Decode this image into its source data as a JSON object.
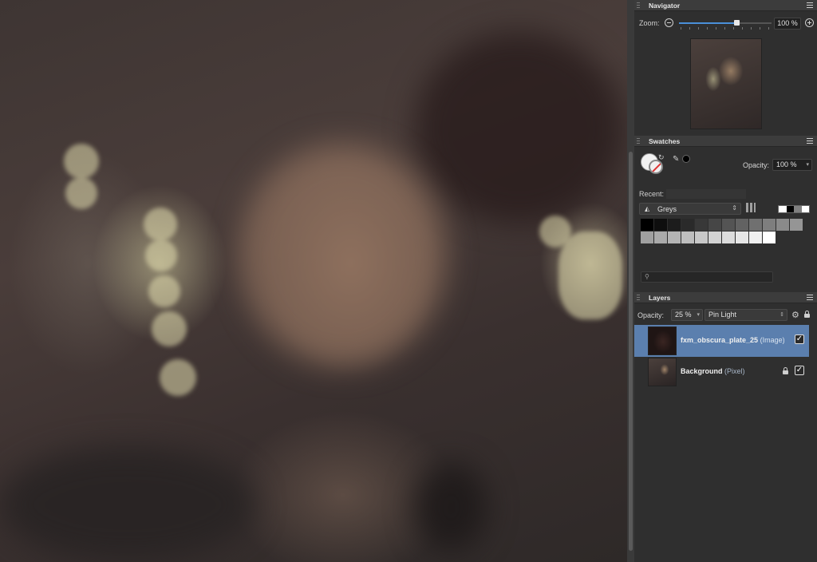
{
  "navigator": {
    "title": "Navigator",
    "zoom_label": "Zoom:",
    "zoom_value": "100 %",
    "zoom_slider_fraction": 0.62
  },
  "swatches": {
    "title": "Swatches",
    "opacity_label": "Opacity:",
    "opacity_value": "100 %",
    "recent_label": "Recent:",
    "palette_name": "Greys",
    "current_color": "#000000",
    "grey_swatches": [
      "#000000",
      "#0e0e0e",
      "#1c1c1c",
      "#2a2a2a",
      "#383838",
      "#464646",
      "#545454",
      "#626262",
      "#707070",
      "#7e7e7e",
      "#8a8a8a",
      "#959595",
      "#a0a0a0",
      "#aaaaaa",
      "#b4b4b4",
      "#bebebe",
      "#c8c8c8",
      "#d2d2d2",
      "#dcdcdc",
      "#e6e6e6",
      "#f0f0f0",
      "#ffffff"
    ],
    "mini_swatches": [
      "#ffffff",
      "#000000",
      "#808080",
      "#ffffff"
    ]
  },
  "layers": {
    "title": "Layers",
    "opacity_label": "Opacity:",
    "opacity_value": "25 %",
    "blend_mode": "Pin Light",
    "items": [
      {
        "name": "fxm_obscura_plate_25",
        "type": "(Image)",
        "visible": true,
        "selected": true,
        "locked": false
      },
      {
        "name": "Background",
        "type": "(Pixel)",
        "visible": true,
        "selected": false,
        "locked": true
      }
    ]
  },
  "colors": {
    "panel_bg": "#2f2f2f",
    "selection": "#5b7fae",
    "accent": "#4a90d9"
  }
}
